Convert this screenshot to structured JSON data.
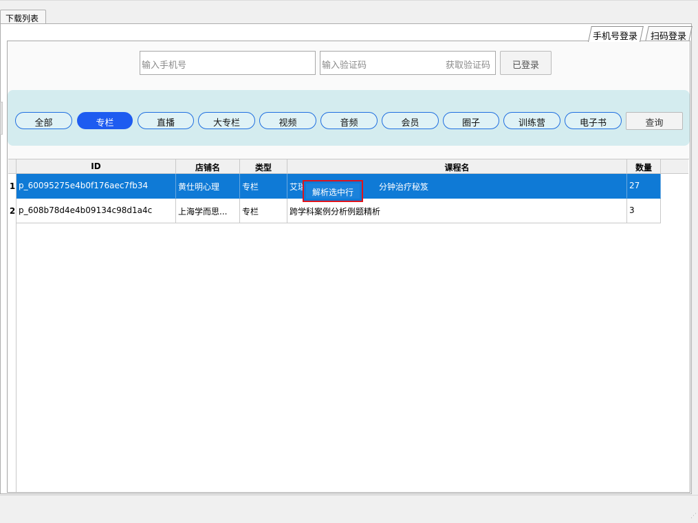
{
  "outer_tab": {
    "label": "下载列表"
  },
  "login_tabs": [
    {
      "label": "手机号登录",
      "active": true
    },
    {
      "label": "扫码登录",
      "active": false
    }
  ],
  "login": {
    "phone_placeholder": "输入手机号",
    "code_placeholder": "输入验证码",
    "get_code_label": "获取验证码",
    "logged_in_label": "已登录"
  },
  "filters": [
    {
      "label": "全部",
      "active": false
    },
    {
      "label": "专栏",
      "active": true
    },
    {
      "label": "直播",
      "active": false
    },
    {
      "label": "大专栏",
      "active": false
    },
    {
      "label": "视频",
      "active": false
    },
    {
      "label": "音频",
      "active": false
    },
    {
      "label": "会员",
      "active": false
    },
    {
      "label": "圈子",
      "active": false
    },
    {
      "label": "训练营",
      "active": false
    },
    {
      "label": "电子书",
      "active": false
    }
  ],
  "query_label": "查询",
  "table": {
    "columns": [
      "ID",
      "店铺名",
      "类型",
      "课程名",
      "数量"
    ],
    "rows": [
      {
        "index": "1",
        "id": "p_60095275e4b0f176aec7fb34",
        "shop": "黄仕明心理",
        "type": "专栏",
        "course_left": "艾瑞",
        "course_right": "分钟治疗秘笈",
        "count": "27",
        "selected": true
      },
      {
        "index": "2",
        "id": "p_608b78d4e4b09134c98d1a4c",
        "shop": "上海学而思...",
        "type": "专栏",
        "course": "跨学科案例分析例题精析",
        "count": "3",
        "selected": false
      }
    ]
  },
  "context_menu": {
    "parse_selected_label": "解析选中行"
  },
  "colors": {
    "accent_pill": "#1e5cf0",
    "selection": "#0f7ad6",
    "filter_band": "#d4ecef",
    "highlight_border": "#e0131a"
  }
}
